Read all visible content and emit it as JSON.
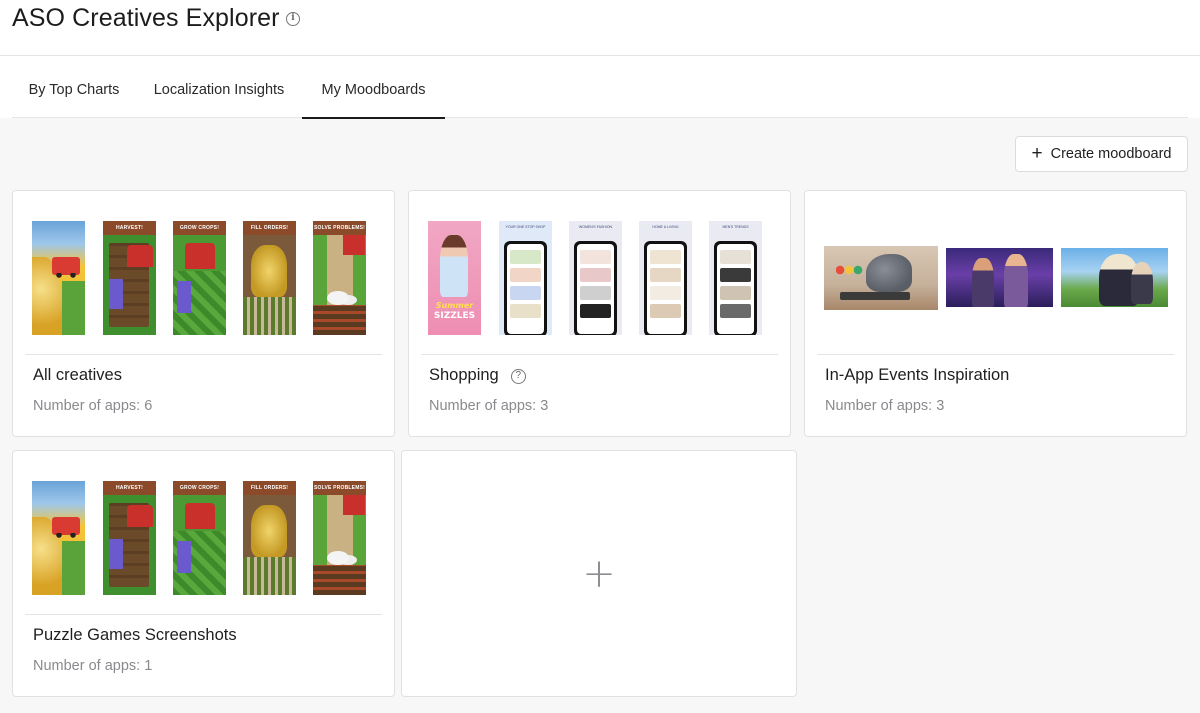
{
  "header": {
    "title": "ASO Creatives Explorer",
    "info_icon": "info-icon"
  },
  "tabs": [
    {
      "label": "By Top Charts",
      "active": false
    },
    {
      "label": "Localization Insights",
      "active": false
    },
    {
      "label": "My Moodboards",
      "active": true
    }
  ],
  "toolbar": {
    "create_label": "Create moodboard",
    "create_icon": "plus-icon"
  },
  "moodboards": [
    {
      "name": "All creatives",
      "count_text": "Number of apps: 6",
      "thumbnails": [
        "farm-game-screenshot-1",
        "farm-game-screenshot-2",
        "farm-game-screenshot-3",
        "farm-game-screenshot-4",
        "farm-game-screenshot-5"
      ]
    },
    {
      "name": "Shopping",
      "count_text": "Number of apps: 3",
      "help_icon": "question-icon",
      "thumbnails": [
        "shopping-screenshot-summer-sizzles",
        "shopping-screenshot-one-stop-shop",
        "shopping-screenshot-womens-fashion",
        "shopping-screenshot-home-living",
        "shopping-screenshot-mens-trends"
      ],
      "thumb_text": {
        "s1_top": "Summer",
        "s1_main": "SIZZLES",
        "s2": "YOUR ONE STOP SHOP",
        "s3": "WOMEN'S FASHION",
        "s4": "HOME & LIVING",
        "s5": "MEN'S TRENDS"
      }
    },
    {
      "name": "In-App Events Inspiration",
      "count_text": "Number of apps: 3",
      "thumbnails": [
        "event-cat-game",
        "event-fantasy-characters",
        "event-anime-field"
      ]
    },
    {
      "name": "Puzzle Games Screenshots",
      "count_text": "Number of apps: 1",
      "thumbnails": [
        "farm-game-screenshot-1",
        "farm-game-screenshot-2",
        "farm-game-screenshot-3",
        "farm-game-screenshot-4",
        "farm-game-screenshot-5"
      ]
    }
  ],
  "game_banners": [
    "HARVEST!",
    "GROW CROPS!",
    "FILL ORDERS!",
    "SOLVE PROBLEMS!"
  ],
  "add_card": {
    "icon": "plus-icon"
  },
  "colors": {
    "tab_underline": "#1b1b1b",
    "muted_text": "#8a8a8e",
    "border": "#e1e1e4"
  }
}
